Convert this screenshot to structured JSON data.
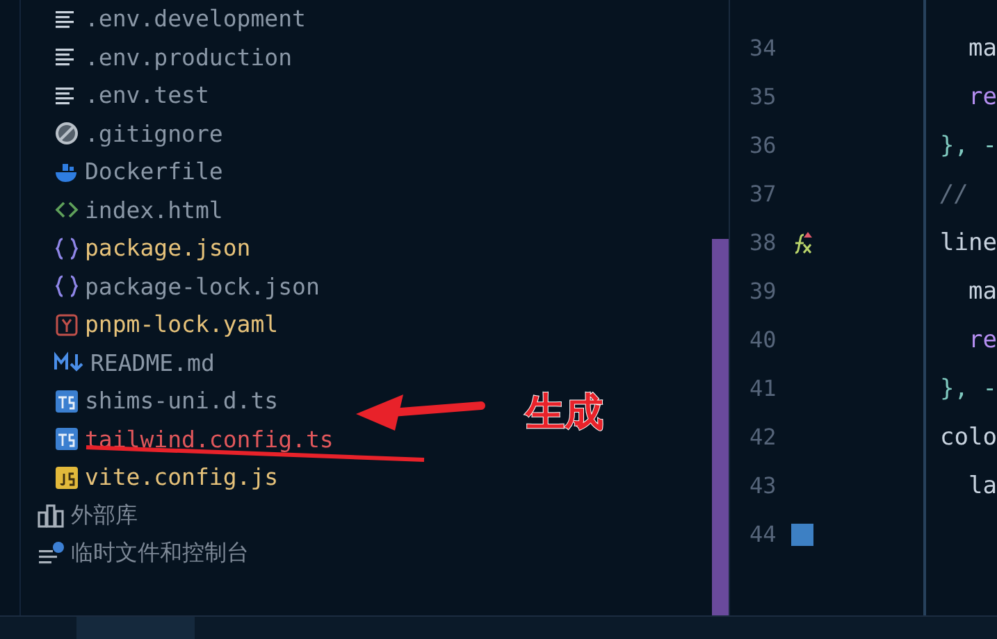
{
  "project_tree": {
    "files": [
      {
        "name": ".env.development",
        "kind": "text",
        "color": "#8a97a6"
      },
      {
        "name": ".env.production",
        "kind": "text",
        "color": "#8a97a6"
      },
      {
        "name": ".env.test",
        "kind": "text",
        "color": "#8a97a6"
      },
      {
        "name": ".gitignore",
        "kind": "ignore",
        "color": "#8a97a6"
      },
      {
        "name": "Dockerfile",
        "kind": "docker",
        "color": "#8a97a6"
      },
      {
        "name": "index.html",
        "kind": "html",
        "color": "#8a97a6"
      },
      {
        "name": "package.json",
        "kind": "json",
        "color": "#e6c27a"
      },
      {
        "name": "package-lock.json",
        "kind": "json",
        "color": "#8a97a6"
      },
      {
        "name": "pnpm-lock.yaml",
        "kind": "yaml",
        "color": "#e6c27a"
      },
      {
        "name": "README.md",
        "kind": "markdown",
        "color": "#8a97a6"
      },
      {
        "name": "shims-uni.d.ts",
        "kind": "ts",
        "color": "#8a97a6"
      },
      {
        "name": "tailwind.config.ts",
        "kind": "ts",
        "color": "#e0575b"
      },
      {
        "name": "vite.config.js",
        "kind": "js",
        "color": "#e6c27a"
      }
    ],
    "roots": [
      {
        "name": "外部库",
        "kind": "library"
      },
      {
        "name": "临时文件和控制台",
        "kind": "scratches"
      }
    ]
  },
  "annotation": {
    "label": "生成"
  },
  "editor": {
    "lines": [
      {
        "number": "34",
        "code": "  ma",
        "kind": "key"
      },
      {
        "number": "35",
        "code": "  re",
        "kind": "keyword"
      },
      {
        "number": "36",
        "code": "}, -",
        "kind": "brace"
      },
      {
        "number": "37",
        "code": "// ",
        "kind": "comment"
      },
      {
        "number": "38",
        "code": "line",
        "kind": "key",
        "marker": {
          "kind": "override"
        }
      },
      {
        "number": "39",
        "code": "  ma",
        "kind": "key"
      },
      {
        "number": "40",
        "code": "  re",
        "kind": "keyword"
      },
      {
        "number": "41",
        "code": "}, -",
        "kind": "brace"
      },
      {
        "number": "42",
        "code": "colo",
        "kind": "key"
      },
      {
        "number": "43",
        "code": "  la",
        "kind": "key"
      },
      {
        "number": "44",
        "marker": {
          "kind": "swatch",
          "color": "#3d80c4"
        }
      }
    ]
  }
}
